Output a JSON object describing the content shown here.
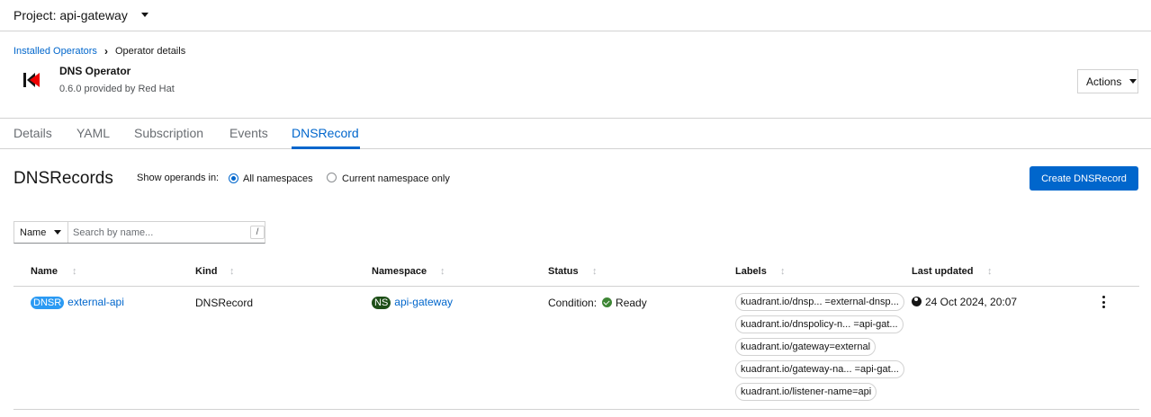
{
  "project": {
    "label": "Project: api-gateway"
  },
  "breadcrumb": {
    "parent": "Installed Operators",
    "separator": "›",
    "current": "Operator details"
  },
  "operator": {
    "name": "DNS Operator",
    "subtitle": "0.6.0 provided by Red Hat"
  },
  "actions": {
    "label": "Actions"
  },
  "tabs": [
    {
      "label": "Details"
    },
    {
      "label": "YAML"
    },
    {
      "label": "Subscription"
    },
    {
      "label": "Events"
    },
    {
      "label": "DNSRecord",
      "active": true
    }
  ],
  "page": {
    "title": "DNSRecords",
    "show_label": "Show operands in:",
    "radio_all": "All namespaces",
    "radio_current": "Current namespace only",
    "selected_radio": "All namespaces",
    "create_label": "Create DNSRecord"
  },
  "filter": {
    "type": "Name",
    "placeholder": "Search by name...",
    "shortcut": "/"
  },
  "table": {
    "columns": [
      "Name",
      "Kind",
      "Namespace",
      "Status",
      "Labels",
      "Last updated"
    ],
    "rows": [
      {
        "name_badge": "DNSR",
        "name": "external-api",
        "kind": "DNSRecord",
        "ns_badge": "NS",
        "namespace": "api-gateway",
        "status_prefix": "Condition:",
        "status": "Ready",
        "labels": [
          "kuadrant.io/dnsp... =external-dnsp...",
          "kuadrant.io/dnspolicy-n... =api-gat...",
          "kuadrant.io/gateway=external",
          "kuadrant.io/gateway-na... =api-gat...",
          "kuadrant.io/listener-name=api"
        ],
        "last_updated": "24 Oct 2024, 20:07"
      }
    ]
  },
  "icons": {
    "operator_logo": "operator-logo-icon",
    "sort": "sort-icon",
    "status_ok": "check-circle-icon",
    "globe": "globe-icon",
    "kebab": "kebab-icon"
  },
  "colors": {
    "link": "#0066cc",
    "primary_button": "#0066cc",
    "dnsr_badge": "#2b9af3",
    "ns_badge": "#1e4f18",
    "ok": "#3e8635",
    "logo_red": "#ee0000"
  }
}
